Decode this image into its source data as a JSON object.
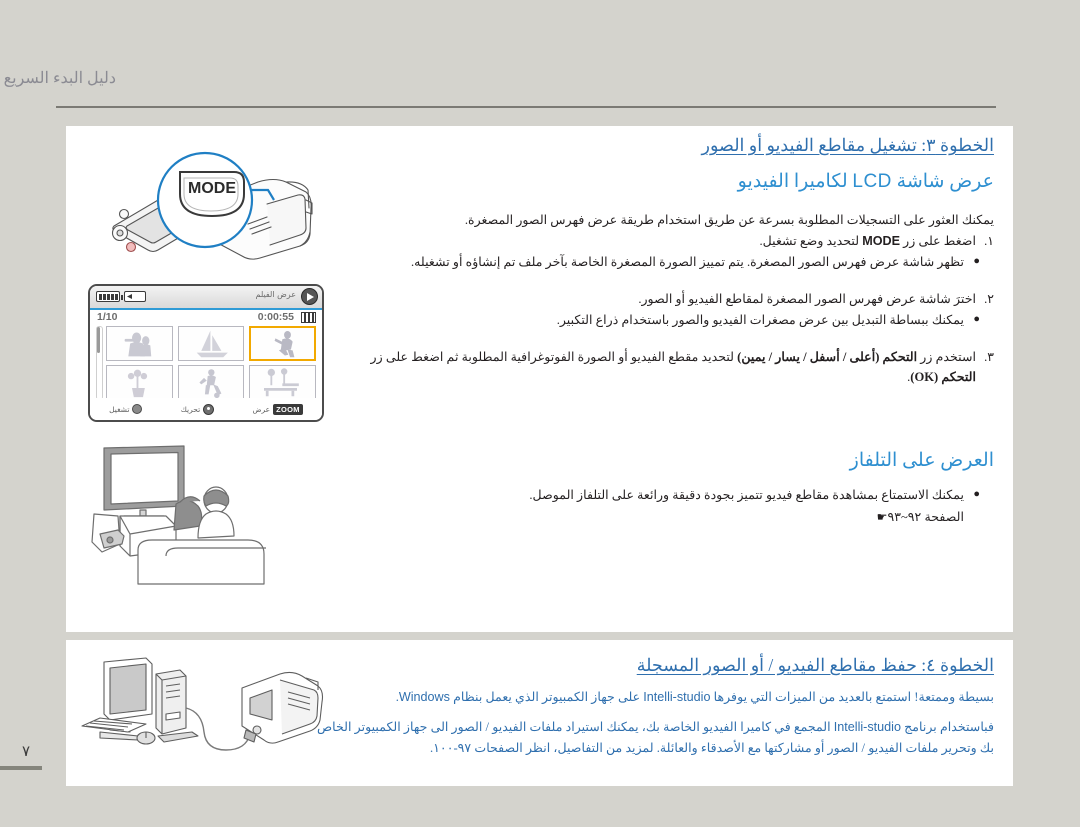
{
  "header": {
    "running_title": "دليل البدء السريع",
    "page_number": "٧"
  },
  "section_playback": {
    "step_heading": "الخطوة ٣: تشغيل مقاطع الفيديو أو الصور",
    "sub_heading_prefix": "عرض شاشة ",
    "sub_heading_lcd": "LCD",
    "sub_heading_suffix": " لكاميرا الفيديو",
    "intro": "يمكنك العثور على التسجيلات المطلوبة بسرعة عن طريق استخدام طريقة عرض فهرس الصور المصغرة.",
    "steps": [
      {
        "marker": "١.",
        "text_before": "اضغط على زر ",
        "bold_token": "MODE",
        "text_after": " لتحديد وضع تشغيل.",
        "bullets": [
          "تظهر شاشة عرض فهرس الصور المصغرة. يتم تمييز الصورة المصغرة الخاصة بآخر ملف تم إنشاؤه أو تشغيله."
        ]
      },
      {
        "marker": "٢.",
        "text_before": "اخترَ شاشة عرض فهرس الصور المصغرة لمقاطع الفيديو أو الصور.",
        "bold_token": "",
        "text_after": "",
        "bullets": [
          "يمكنك ببساطة التبديل بين عرض مصغرات الفيديو والصور باستخدام ذراع التكبير."
        ]
      },
      {
        "marker": "٣.",
        "text_before": "استخدم زر ",
        "bold_token": "التحكم (أعلى / أسفل / يسار / يمين)",
        "text_after": " لتحديد مقطع الفيديو أو الصورة الفوتوغرافية المطلوبة ثم اضغط على زر ",
        "bold_token2": "التحكم (OK)",
        "text_after2": ".",
        "bullets": []
      }
    ]
  },
  "section_tv": {
    "heading": "العرض على التلفاز",
    "bullet": "يمكنك الاستمتاع بمشاهدة مقاطع فيديو تتميز بجودة دقيقة ورائعة على التلفاز الموصل.",
    "page_ref": "الصفحة ٩٢~٩٣",
    "page_ref_icon": "☛"
  },
  "section_save": {
    "step_heading": "الخطوة ٤: حفظ مقاطع الفيديو / أو الصور المسجلة",
    "para1_a": "بسيطة وممتعة! استمتع بالعديد من الميزات التي يوفرها ",
    "para1_app": "Intelli-studio",
    "para1_b": " على جهاز الكمبيوتر الذي يعمل بنظام ",
    "para1_os": "Windows",
    "para1_c": ".",
    "para2_a": "فباستخدام برنامج ",
    "para2_app": "Intelli-studio",
    "para2_b": " المجمع في كاميرا الفيديو الخاصة بك، يمكنك استيراد ملفات الفيديو / الصور الى جهاز الكمبيوتر الخاص بك وتحرير ملفات الفيديو / الصور أو مشاركتها مع الأصدقاء والعائلة. لمزيد من التفاصيل، انظر الصفحات ٩٧-١٠٠."
  },
  "figures": {
    "camcorder_mode": {
      "name": "camcorder-mode-button-illustration",
      "callout_label": "MODE"
    },
    "lcd": {
      "name": "lcd-thumbnail-index-illustration",
      "status_mode_label": "عرض الفيلم",
      "file_count": "1/10",
      "duration": "0:00:55",
      "footer_buttons": [
        {
          "label": "تشغيل",
          "icon": "record-circle-icon"
        },
        {
          "label": "تحريك",
          "icon": "dpad-icon"
        },
        {
          "label": "عرض",
          "icon": "zoom-label-icon"
        }
      ],
      "selected_thumb_index": 2,
      "thumbnails": [
        "people-photo-thumb",
        "sailboat-thumb",
        "golfer-thumb",
        "flower-pot-thumb",
        "soccer-player-thumb",
        "park-bench-thumb"
      ]
    },
    "tv_scene": {
      "name": "tv-viewing-illustration"
    },
    "pc_connect": {
      "name": "pc-camcorder-connection-illustration"
    }
  },
  "colors": {
    "page_bg": "#d4d3cd",
    "panel_bg": "#ffffff",
    "heading_blue": "#2f6fae",
    "subheading_blue": "#2e8fd0",
    "body_text": "#231f20",
    "rule_gray": "#7b7a74",
    "lcd_select": "#f2a900"
  }
}
